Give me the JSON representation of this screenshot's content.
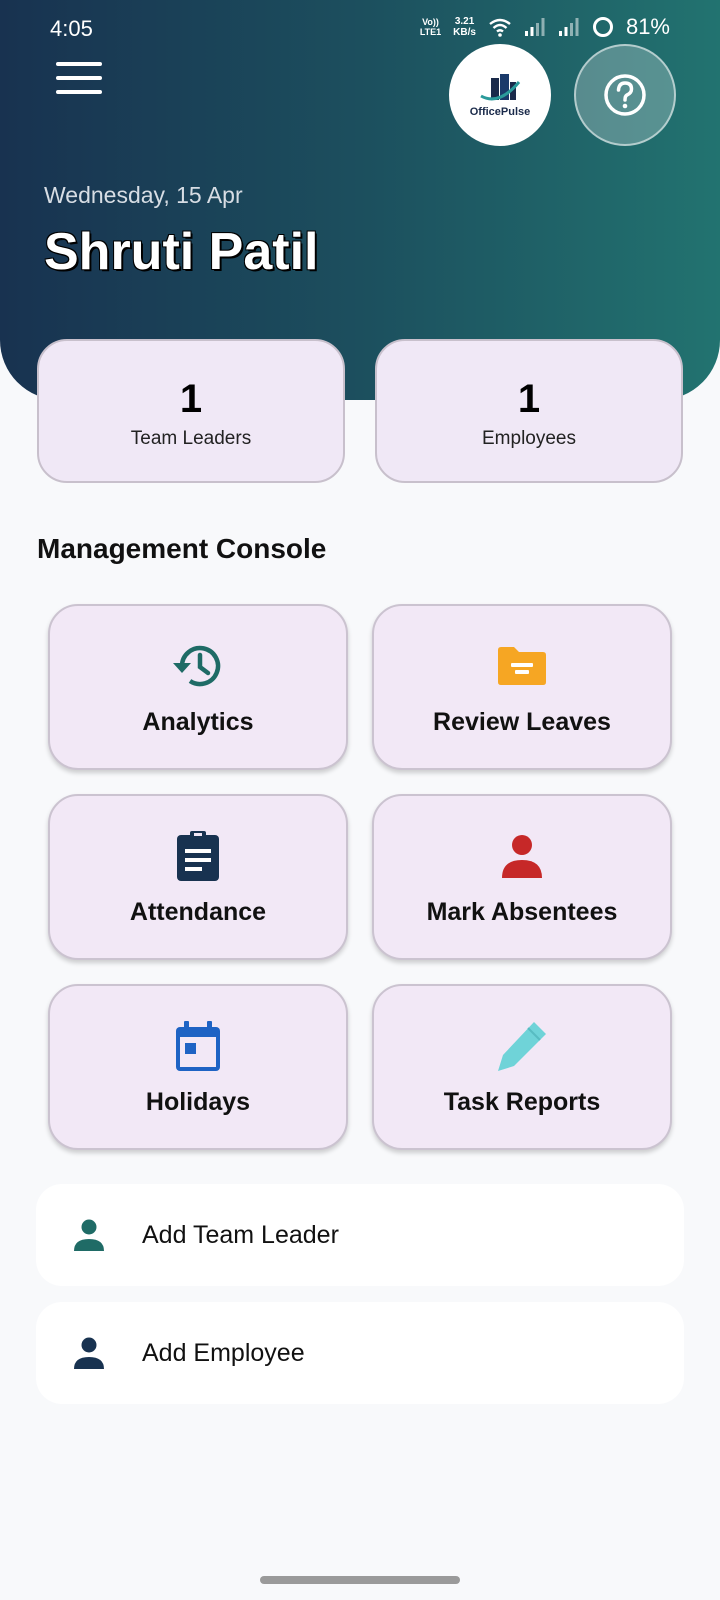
{
  "status_bar": {
    "time": "4:05",
    "volte_top": "Vo))",
    "volte_bottom": "LTE1",
    "net_speed_value": "3.21",
    "net_speed_unit": "KB/s",
    "battery": "81%"
  },
  "header": {
    "logo_text": "OfficePulse",
    "date": "Wednesday, 15 Apr",
    "user_name": "Shruti Patil",
    "accent_start": "#183250",
    "accent_end": "#227370"
  },
  "stats": [
    {
      "value": "1",
      "label": "Team Leaders"
    },
    {
      "value": "1",
      "label": "Employees"
    }
  ],
  "section_title": "Management Console",
  "tiles": [
    {
      "label": "Analytics",
      "icon": "history-icon",
      "color": "#1f6b66"
    },
    {
      "label": "Review Leaves",
      "icon": "folder-icon",
      "color": "#f6a623"
    },
    {
      "label": "Attendance",
      "icon": "clipboard-icon",
      "color": "#183250"
    },
    {
      "label": "Mark Absentees",
      "icon": "person-icon",
      "color": "#c62828"
    },
    {
      "label": "Holidays",
      "icon": "calendar-icon",
      "color": "#1e63c4"
    },
    {
      "label": "Task Reports",
      "icon": "pencil-icon",
      "color": "#6fd3d8"
    }
  ],
  "actions": [
    {
      "label": "Add Team Leader",
      "icon": "person-icon",
      "color": "#1f6b66"
    },
    {
      "label": "Add Employee",
      "icon": "person-icon",
      "color": "#183250"
    }
  ]
}
